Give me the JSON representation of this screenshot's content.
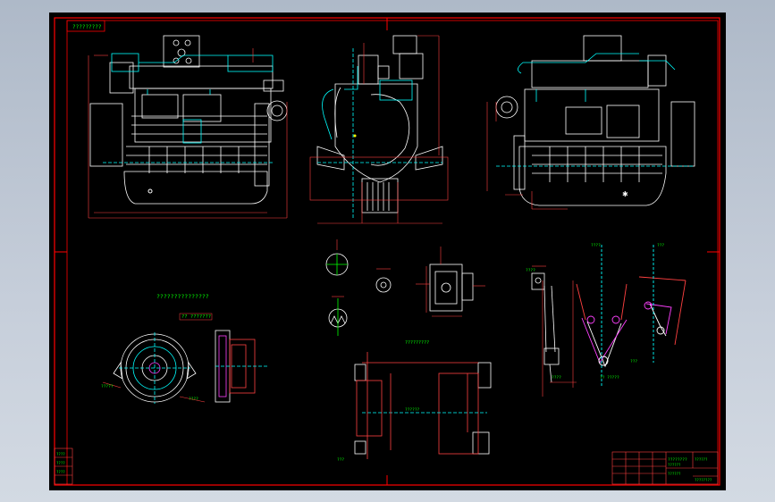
{
  "app": {
    "background": "#000000",
    "window_bg": "#b7c1cf"
  },
  "colors": {
    "frame": "#ff0000",
    "linework": "#ffffff",
    "dim": "#ff2020",
    "centerline": "#00ffff",
    "section": "#ff40ff",
    "text": "#00ff00",
    "accent": "#ffff00"
  },
  "drawing": {
    "title_tab": "?????????",
    "view_side_label": "???????",
    "assembly_note": "???????????????",
    "flywheel_view_label": "?? ???????",
    "bracket_view_label": "?????????",
    "mount_dim_label": "??????",
    "pivot_view_label": "?? ?????",
    "detail_dim_a": "????",
    "detail_dim_b": "???",
    "rod_dim_label": "????",
    "rod_top_label": "????",
    "rod_top_label_b": "???",
    "left_stack_labels": [
      "????",
      "????",
      "????"
    ],
    "title_block": {
      "name": "????????",
      "code": "??????",
      "scale": "??????",
      "sheet": "??????",
      "part_no": "????????"
    }
  }
}
